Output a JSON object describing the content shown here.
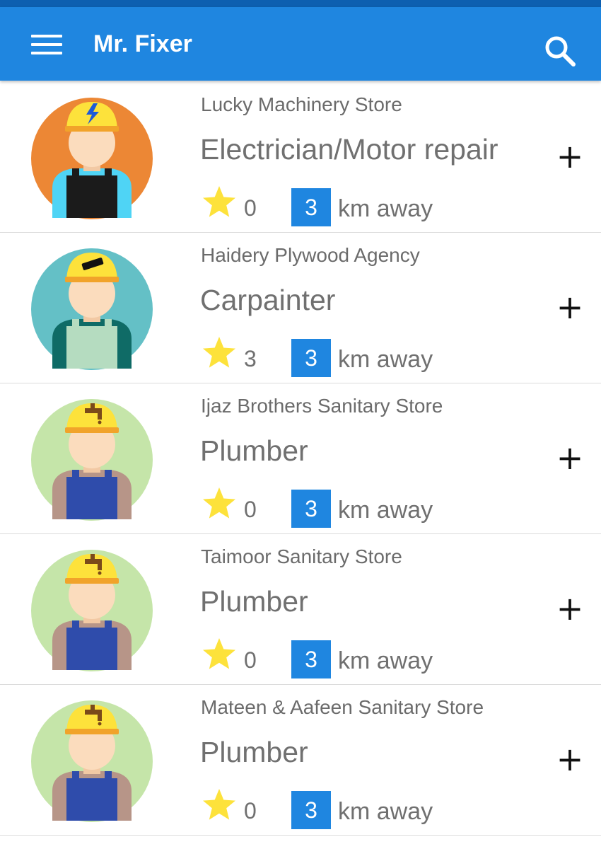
{
  "app": {
    "title": "Mr. Fixer",
    "menu_icon": "hamburger-menu-icon",
    "search_icon": "search-icon",
    "accent": "#1f86e0",
    "statusbar": "#0d5fb0"
  },
  "listing": {
    "distance_unit": "km away",
    "add_symbol": "+",
    "items": [
      {
        "store": "Lucky Machinery Store",
        "service": "Electrician/Motor repair",
        "rating": "0",
        "distance": "3",
        "avatar": "electrician-avatar-icon",
        "bg": "#ec8735",
        "shirt": "#4fd4f5",
        "overall": "#1b1b1b"
      },
      {
        "store": "Haidery Plywood Agency",
        "service": "Carpainter",
        "rating": "3",
        "distance": "3",
        "avatar": "carpenter-avatar-icon",
        "bg": "#64c0c6",
        "shirt": "#0f6b66",
        "overall": "#b5dcc0"
      },
      {
        "store": "Ijaz Brothers Sanitary Store",
        "service": "Plumber",
        "rating": "0",
        "distance": "3",
        "avatar": "plumber-avatar-icon",
        "bg": "#c5e5a9",
        "shirt": "#b79588",
        "overall": "#2f4cab"
      },
      {
        "store": "Taimoor Sanitary Store",
        "service": "Plumber",
        "rating": "0",
        "distance": "3",
        "avatar": "plumber-avatar-icon",
        "bg": "#c5e5a9",
        "shirt": "#b79588",
        "overall": "#2f4cab"
      },
      {
        "store": "Mateen & Aafeen Sanitary Store",
        "service": "Plumber",
        "rating": "0",
        "distance": "3",
        "avatar": "plumber-avatar-icon",
        "bg": "#c5e5a9",
        "shirt": "#b79588",
        "overall": "#2f4cab"
      }
    ]
  }
}
